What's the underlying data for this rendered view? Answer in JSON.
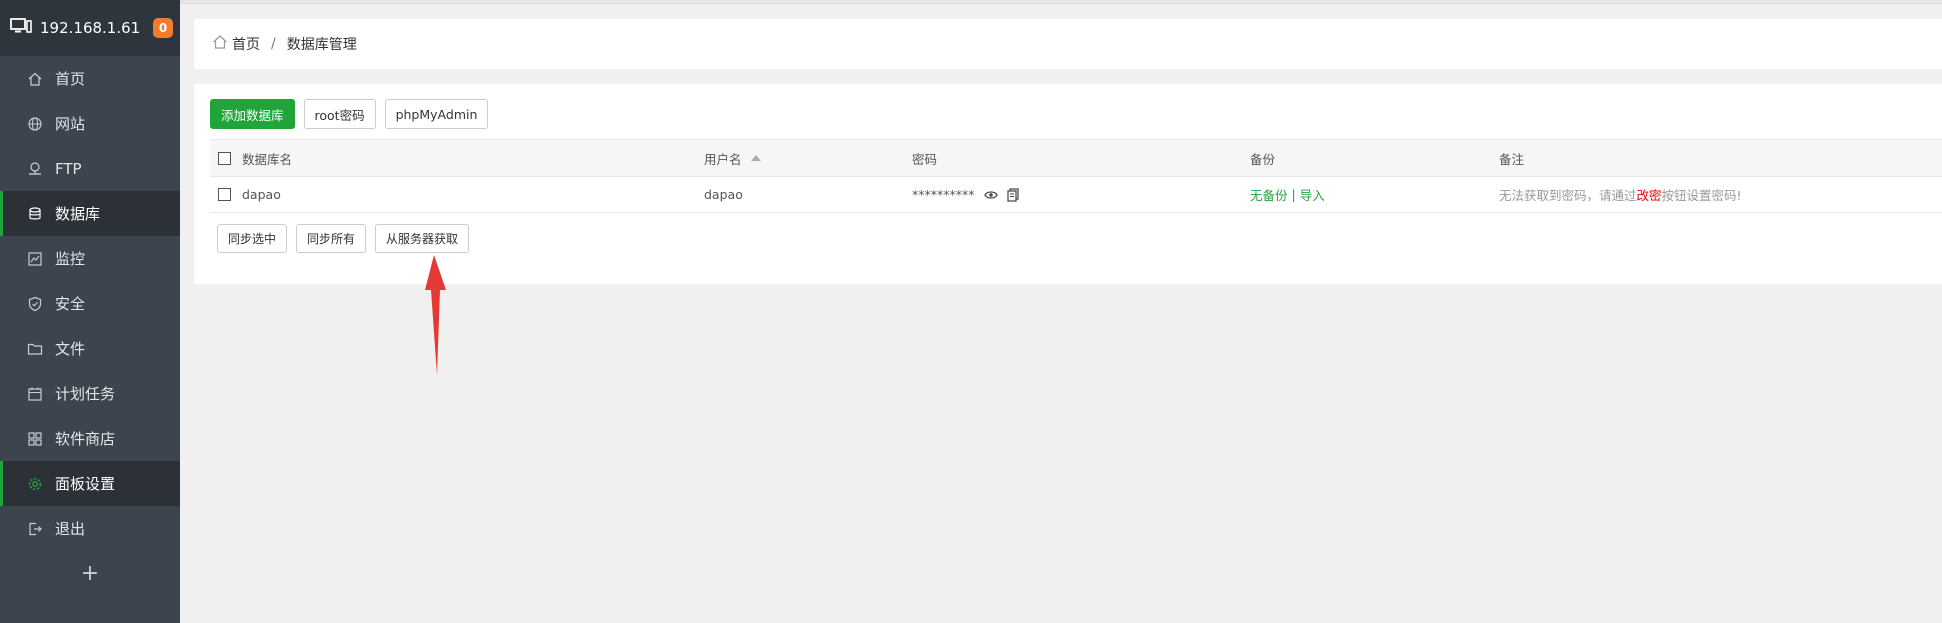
{
  "sidebar": {
    "host": "192.168.1.61",
    "badge": "0",
    "items": [
      {
        "label": "首页",
        "icon": "home-icon"
      },
      {
        "label": "网站",
        "icon": "globe-icon"
      },
      {
        "label": "FTP",
        "icon": "ftp-icon"
      },
      {
        "label": "数据库",
        "icon": "database-icon"
      },
      {
        "label": "监控",
        "icon": "monitor-icon"
      },
      {
        "label": "安全",
        "icon": "shield-icon"
      },
      {
        "label": "文件",
        "icon": "folder-icon"
      },
      {
        "label": "计划任务",
        "icon": "calendar-icon"
      },
      {
        "label": "软件商店",
        "icon": "apps-icon"
      },
      {
        "label": "面板设置",
        "icon": "gear-icon"
      },
      {
        "label": "退出",
        "icon": "logout-icon"
      }
    ],
    "add_label": "+"
  },
  "breadcrumb": {
    "home": "首页",
    "separator": "/",
    "current": "数据库管理"
  },
  "toolbar": {
    "add_db": "添加数据库",
    "root_pwd": "root密码",
    "phpmyadmin": "phpMyAdmin"
  },
  "table": {
    "headers": {
      "name": "数据库名",
      "user": "用户名",
      "password": "密码",
      "backup": "备份",
      "note": "备注"
    },
    "rows": [
      {
        "name": "dapao",
        "user": "dapao",
        "password": "**********",
        "backup_none": "无备份",
        "backup_sep": "|",
        "backup_import": "导入",
        "note_prefix": "无法获取到密码，请通过",
        "note_link": "改密",
        "note_suffix": "按钮设置密码!"
      }
    ]
  },
  "bottom_toolbar": {
    "sync_selected": "同步选中",
    "sync_all": "同步所有",
    "fetch_server": "从服务器获取"
  },
  "colors": {
    "sidebar_bg": "#3c444d",
    "accent": "#20a53a",
    "badge": "#f07d2e",
    "arrow": "#e53935"
  }
}
